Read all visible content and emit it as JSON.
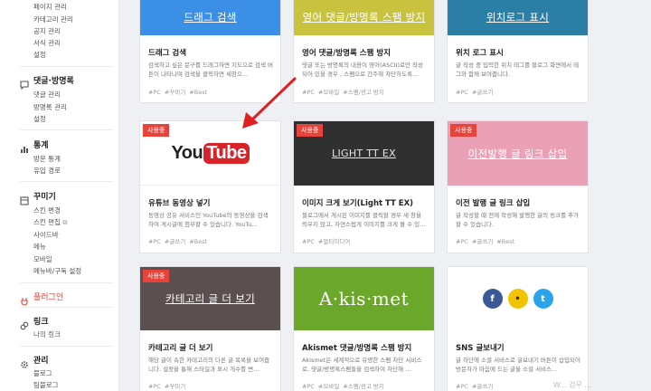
{
  "sidebar": {
    "top_items": [
      "페이지 관리",
      "카테고리 관리",
      "공지 관리",
      "서식 관리",
      "설정"
    ],
    "comments": {
      "title": "댓글·방명록",
      "items": [
        "댓글 관리",
        "방명록 관리",
        "설정"
      ]
    },
    "stats": {
      "title": "통계",
      "items": [
        "방문 통계",
        "유입 경로"
      ]
    },
    "decorate": {
      "title": "꾸미기",
      "items": [
        "스킨 변경",
        "스킨 편집",
        "사이드바",
        "메뉴",
        "모바일",
        "메뉴바/구독 설정"
      ]
    },
    "plugin": {
      "title": "플러그인"
    },
    "link": {
      "title": "링크",
      "items": [
        "나의 링크"
      ]
    },
    "manage": {
      "title": "관리",
      "items": [
        "블로그",
        "팀블로그"
      ]
    }
  },
  "cards": [
    {
      "thumb": "드래그 검색",
      "name": "드래그 검색",
      "desc": "검색하고 싶은 문구를 드래그하면 지도으로 검색 버튼이 나타나며 검색을 클릭하면 세창으...",
      "tags": [
        "#PC",
        "#꾸미기",
        "#Best"
      ],
      "badge": ""
    },
    {
      "thumb": "영어 댓글/방명록 스팸 방지",
      "name": "영어 댓글/방명록 스팸 방지",
      "desc": "댓글 또는 방명록의 내용이 영어(ASCII)로만 작성되어 있을 경우 , 스팸으로 간주해 차단하도록...",
      "tags": [
        "#PC",
        "#모바일",
        "#스팸/광고 방지"
      ],
      "badge": ""
    },
    {
      "thumb": "위치로그 표시",
      "name": "위치 로그 표시",
      "desc": "글 작성 중 입력한 위치 태그를 블로그 화면에서 태그와 함께 보여줍니다.",
      "tags": [
        "#PC",
        "#글쓰기"
      ],
      "badge": ""
    },
    {
      "thumb": "",
      "name": "유튜브 동영상 넣기",
      "desc": "동영상 공유 서비스인 YouTube의 동영상을 검색하여 게시글에 첨부할 수 있습니다. YouTu...",
      "tags": [
        "#PC",
        "#글쓰기",
        "#Best"
      ],
      "badge": "사용중",
      "logo_you": "You",
      "logo_tube": "Tube"
    },
    {
      "thumb": "LIGHT TT EX",
      "name": "이미지 크게 보기(Light TT EX)",
      "desc": "블로그에서 게시된 이미지를 클릭할 경우 새 창을 띄우지 않고, 자연스럽게 이미지를 크게 볼 수 있...",
      "tags": [
        "#PC",
        "#멀티미디어"
      ],
      "badge": "사용중"
    },
    {
      "thumb": "이전발행 글 링크 삽입",
      "name": "이전 발행 글 링크 삽입",
      "desc": "글 작성할 때 전에 작성해 발행한 글의 링크를 추가할 수 있습니다.",
      "tags": [
        "#PC",
        "#글쓰기",
        "#Best"
      ],
      "badge": "사용중"
    },
    {
      "thumb": "카테고리 글 더 보기",
      "name": "카테고리 글 더 보기",
      "desc": "해당 글이 속한 카테고리의 다른 글 목록을 보여줍니다. 설정을 통해 스타일과 표시 개수를 변...",
      "tags": [
        "#PC",
        "#꾸미기"
      ],
      "badge": "사용중"
    },
    {
      "thumb": "A·kis·met",
      "name": "Akismet 댓글/방명록 스팸 방지",
      "desc": "Akismet은 세계적으로 유명한 스팸 차단 서비스로, 댓글/방명록스팸들을 검색하여 차단해 ...",
      "tags": [
        "#PC",
        "#모바일",
        "#스팸/광고 방지"
      ],
      "badge": ""
    },
    {
      "thumb": "",
      "name": "SNS 글보내기",
      "desc": "글 하단에 소셜 서비스로 글보내기 버튼이 삽입되어 방문자가 마음에 드는 글을 소셜 서비스...",
      "tags": [
        "#PC",
        "#글쓰기"
      ],
      "badge": "",
      "sns": [
        "f",
        "•",
        "t"
      ]
    }
  ],
  "colors": {
    "drag": "#3b8fe6",
    "english": "#c9c23f",
    "location": "#2b7ea6",
    "light": "#303030",
    "prevlink": "#eba1b5",
    "catmore": "#5b4f4f",
    "akismet": "#6aa72a",
    "fb": "#3b5998",
    "kakao": "#f2c300",
    "tw": "#2aa3ef",
    "arrow": "#e02020",
    "accent": "#e8433a"
  },
  "icons": {
    "comments": "chat-bubble-icon",
    "stats": "bar-chart-icon",
    "decorate": "palette-icon",
    "plugin": "plug-icon",
    "link": "link-chain-icon",
    "manage": "gear-icon",
    "external": "external-link-icon"
  },
  "watermark": "W... 검무 ..."
}
